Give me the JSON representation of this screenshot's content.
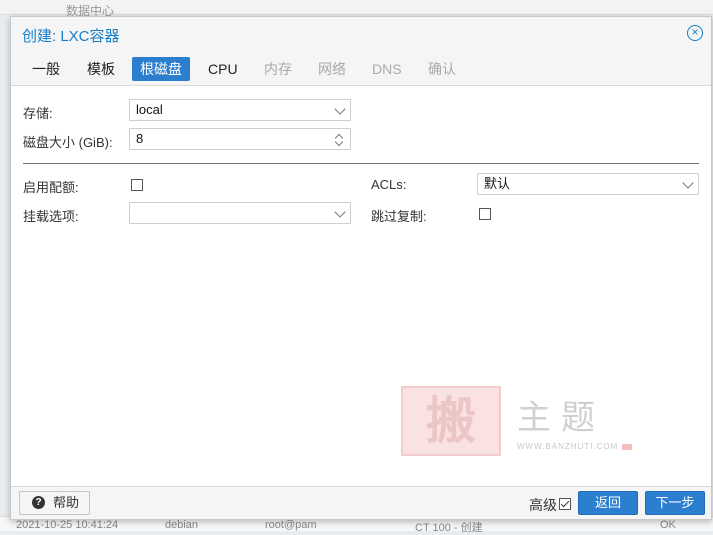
{
  "background": {
    "breadcrumb": "数据中心",
    "row": [
      "2021-10-25 10:41:24",
      "debian",
      "root@pam",
      "CT 100 - 创建",
      "OK"
    ]
  },
  "dialog": {
    "title": "创建: LXC容器",
    "tabs": [
      {
        "label": "一般",
        "state": "normal"
      },
      {
        "label": "模板",
        "state": "normal"
      },
      {
        "label": "根磁盘",
        "state": "active"
      },
      {
        "label": "CPU",
        "state": "normal"
      },
      {
        "label": "内存",
        "state": "disabled"
      },
      {
        "label": "网络",
        "state": "disabled"
      },
      {
        "label": "DNS",
        "state": "disabled"
      },
      {
        "label": "确认",
        "state": "disabled"
      }
    ]
  },
  "form": {
    "storage": {
      "label": "存储:",
      "value": "local"
    },
    "disk_size": {
      "label": "磁盘大小 (GiB):",
      "value": "8"
    },
    "quota": {
      "label": "启用配额:",
      "checked": false
    },
    "mount_options": {
      "label": "挂载选项:",
      "value": ""
    },
    "acls": {
      "label": "ACLs:",
      "value": "默认"
    },
    "skip_replication": {
      "label": "跳过复制:",
      "checked": false
    }
  },
  "watermark": {
    "seal": "搬",
    "text": "主题",
    "url": "WWW.BANZHUTI.COM"
  },
  "footer": {
    "help_label": "帮助",
    "advanced_label": "高级",
    "advanced_checked": true,
    "back_label": "返回",
    "next_label": "下一步"
  },
  "colors": {
    "accent": "#2b7fce",
    "title": "#157fcc"
  }
}
